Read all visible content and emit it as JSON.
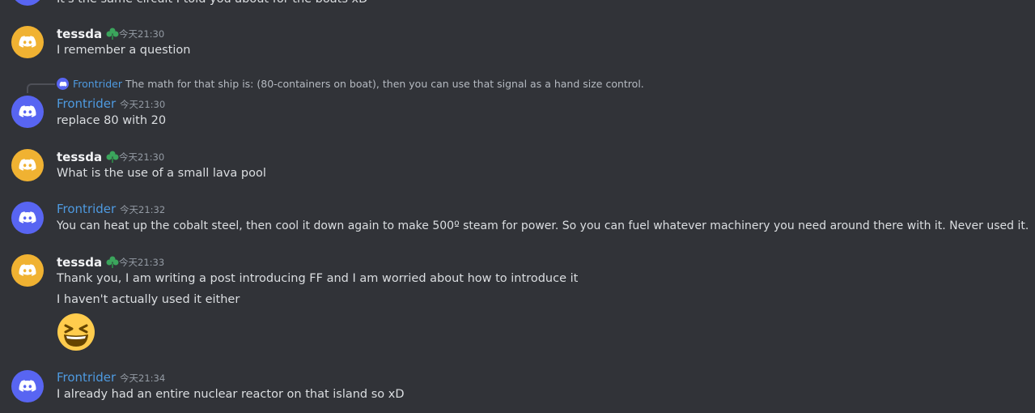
{
  "colors": {
    "background": "#313338",
    "tessda_avatar": "#f0b232",
    "frontrider_avatar": "#5865f2",
    "frontrider_name": "#4e9ae0",
    "badge": "#3ba55c"
  },
  "messages": [
    {
      "text": "It's the same circuit I told you about for the boats xD"
    },
    {
      "username": "tessda",
      "badge_icon": "leaf-badge-icon",
      "timestamp": "今天21:30",
      "text": "I remember a question"
    },
    {
      "reply": {
        "username": "Frontrider",
        "text": "The math for that ship is: (80-containers on boat), then you can use that signal as a hand size control."
      },
      "username": "Frontrider",
      "timestamp": "今天21:30",
      "text": "replace 80 with 20"
    },
    {
      "username": "tessda",
      "badge_icon": "leaf-badge-icon",
      "timestamp": "今天21:30",
      "text": "What is the use of a small lava pool"
    },
    {
      "username": "Frontrider",
      "timestamp": "今天21:32",
      "text": "You can heat up the cobalt steel, then cool it down again to make 500º steam for power. So you can fuel whatever machinery you need around there with it. Never used it."
    },
    {
      "username": "tessda",
      "badge_icon": "leaf-badge-icon",
      "timestamp": "今天21:33",
      "text": "Thank you, I am writing a post introducing FF and I am worried about how to introduce it",
      "text2": "I haven't actually used it either",
      "emoji": "laughing-emoji"
    },
    {
      "username": "Frontrider",
      "timestamp": "今天21:34",
      "text": "I already had an entire nuclear reactor on that island so xD"
    }
  ]
}
